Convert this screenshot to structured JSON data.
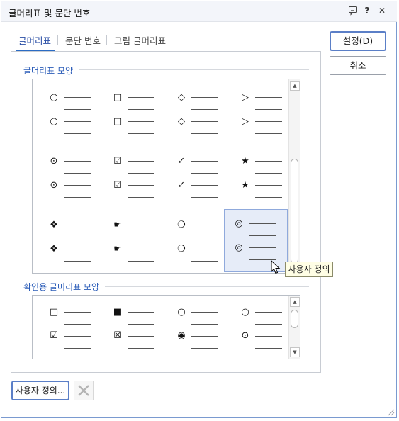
{
  "window": {
    "title": "글머리표 및 문단 번호"
  },
  "titlebar_icons": [
    "comment-icon",
    "help-icon",
    "close-icon"
  ],
  "titlebar_glyphs": {
    "help": "?",
    "close": "✕"
  },
  "tabs": [
    {
      "label": "글머리표",
      "active": true
    },
    {
      "label": "문단 번호",
      "active": false
    },
    {
      "label": "그림 글머리표",
      "active": false
    }
  ],
  "buttons": {
    "ok": "설정(D)",
    "cancel": "취소",
    "custom": "사용자 정의..."
  },
  "bullet_shapes": {
    "title": "글머리표 모양",
    "cells": [
      {
        "symbol": "○",
        "icon": "circle-icon"
      },
      {
        "symbol": "□",
        "icon": "square-icon"
      },
      {
        "symbol": "◇",
        "icon": "diamond-icon"
      },
      {
        "symbol": "▷",
        "icon": "triangle-icon"
      },
      {
        "symbol": "⊙",
        "icon": "dot-circle-icon"
      },
      {
        "symbol": "☑",
        "icon": "checked-box-icon"
      },
      {
        "symbol": "✓",
        "icon": "check-icon"
      },
      {
        "symbol": "★",
        "icon": "star-icon"
      },
      {
        "symbol": "❖",
        "icon": "four-diamond-icon"
      },
      {
        "symbol": "☛",
        "icon": "pointing-hand-icon"
      },
      {
        "symbol": "❍",
        "icon": "shadow-circle-icon"
      },
      {
        "symbol": "◎",
        "icon": "bullseye-icon",
        "selected": true
      }
    ]
  },
  "check_bullet_shapes": {
    "title": "확인용 글머리표 모양",
    "cells": [
      {
        "symbol": "□",
        "checked_symbol": "☑",
        "icon": "checkbox-icon"
      },
      {
        "symbol": "■",
        "checked_symbol": "☒",
        "icon": "shadow-checkbox-icon"
      },
      {
        "symbol": "○",
        "checked_symbol": "◉",
        "icon": "radio-icon"
      },
      {
        "symbol": "○",
        "checked_symbol": "⊙",
        "icon": "bold-radio-icon"
      }
    ]
  },
  "tooltip": "사용자 정의",
  "scroll_glyphs": {
    "up": "▲",
    "down": "▼"
  }
}
